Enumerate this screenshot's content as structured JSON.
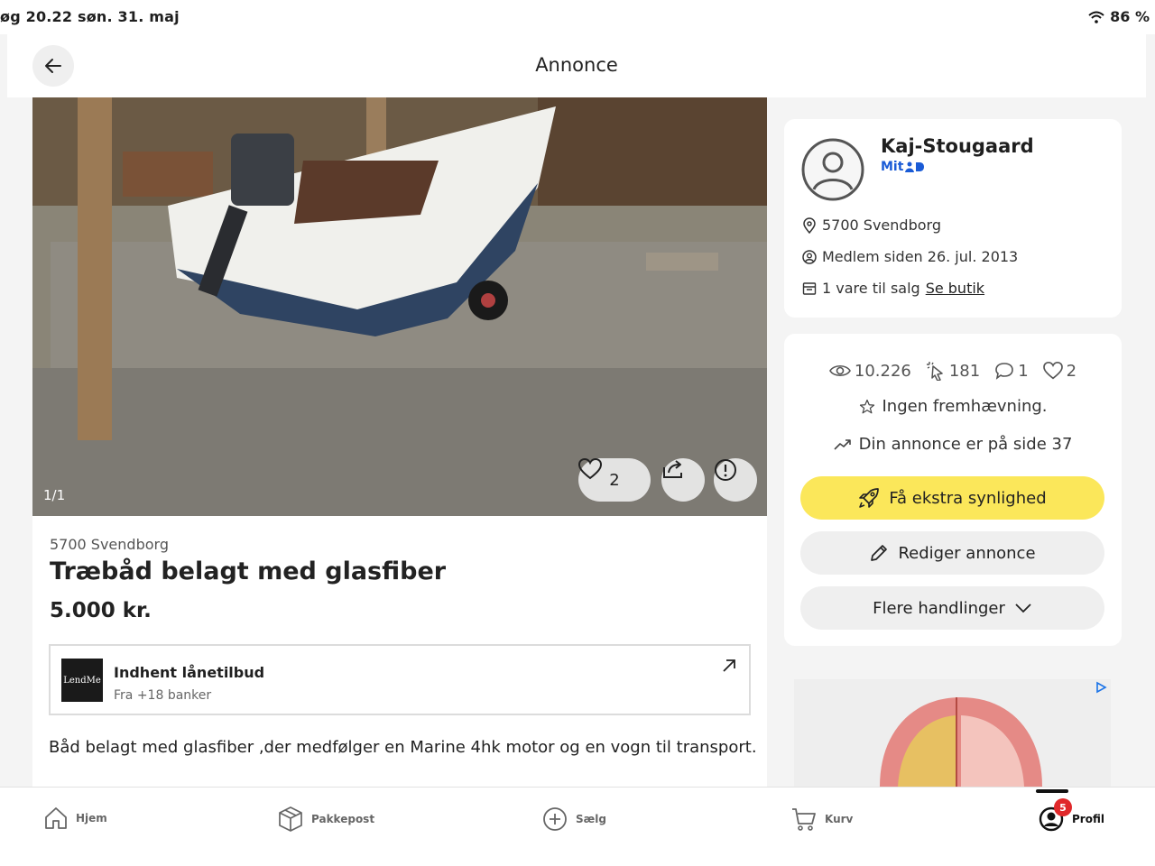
{
  "status": {
    "left_text": "øg  20.22  søn. 31. maj",
    "battery": "86 %"
  },
  "header": {
    "title": "Annonce"
  },
  "listing": {
    "image_counter": "1/1",
    "favorites_count": "2",
    "location": "5700 Svendborg",
    "title": "Træbåd belagt med glasfiber",
    "price": "5.000 kr.",
    "description": "Båd belagt med glasfiber ,der medfølger en Marine 4hk motor og en vogn til transport."
  },
  "loan": {
    "logo": "LendMe",
    "title": "Indhent lånetilbud",
    "subtitle": "Fra +18 banker"
  },
  "seller": {
    "name": "Kaj-Stougaard",
    "verified_label": "Mit",
    "location": "5700 Svendborg",
    "member_since": "Medlem siden 26. jul. 2013",
    "items_for_sale": "1 vare til salg",
    "shop_link": "Se butik"
  },
  "stats": {
    "views": "10.226",
    "clicks": "181",
    "messages": "1",
    "favorites": "2",
    "promotion": "Ingen fremhævning.",
    "position": "Din annonce er på side 37"
  },
  "actions": {
    "boost": "Få ekstra synlighed",
    "edit": "Rediger annonce",
    "more": "Flere handlinger"
  },
  "tabbar": {
    "home": "Hjem",
    "parcel": "Pakkepost",
    "sell": "Sælg",
    "cart": "Kurv",
    "profile": "Profil",
    "profile_badge": "5"
  },
  "colors": {
    "accent_yellow": "#fbe75a",
    "button_gray": "#efefef",
    "badge_red": "#e0282a",
    "mitid_blue": "#1a5bd6"
  }
}
